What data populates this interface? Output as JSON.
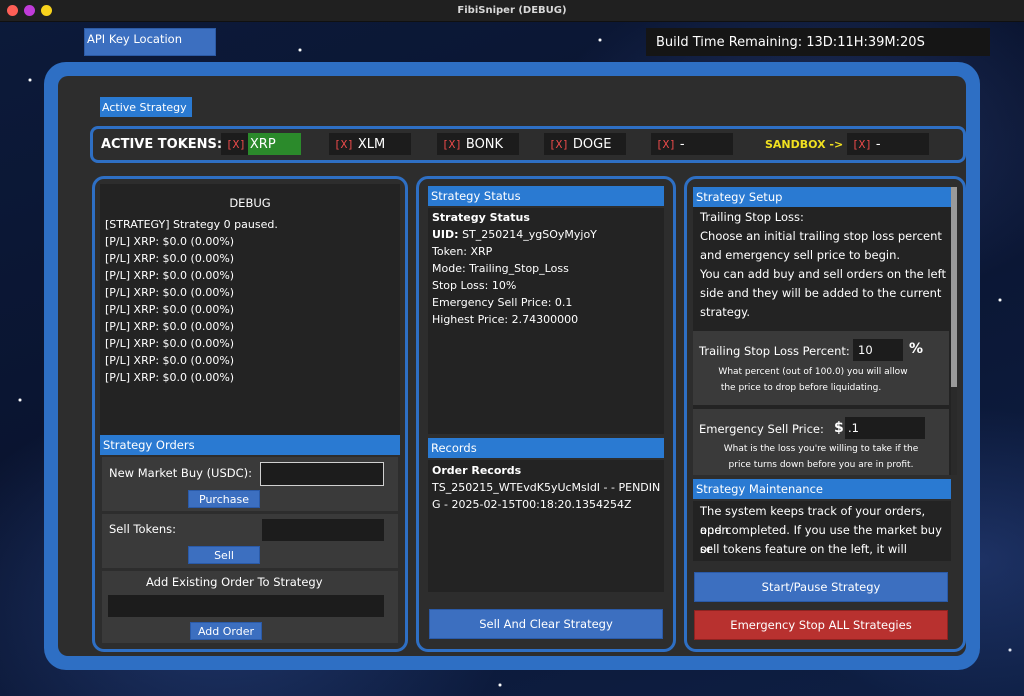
{
  "window": {
    "title": "FibiSniper (DEBUG)"
  },
  "top": {
    "api_key_label": "API Key Location",
    "build_time": "Build Time Remaining: 13D:11H:39M:20S"
  },
  "active_strategy_tab": "Active Strategy",
  "tokens": {
    "label": "ACTIVE TOKENS:",
    "sandbox_label": "SANDBOX ->",
    "remove_marker": "[X]",
    "items": [
      {
        "name": "XRP",
        "selected": true
      },
      {
        "name": "XLM",
        "selected": false
      },
      {
        "name": "BONK",
        "selected": false
      },
      {
        "name": "DOGE",
        "selected": false
      },
      {
        "name": "-",
        "selected": false
      }
    ],
    "sandbox_item": {
      "name": "-"
    }
  },
  "debug": {
    "title": "DEBUG",
    "lines": [
      "[STRATEGY] Strategy 0 paused.",
      "[P/L] XRP: $0.0 (0.00%)",
      "[P/L] XRP: $0.0 (0.00%)",
      "[P/L] XRP: $0.0 (0.00%)",
      "[P/L] XRP: $0.0 (0.00%)",
      "[P/L] XRP: $0.0 (0.00%)",
      "[P/L] XRP: $0.0 (0.00%)",
      "[P/L] XRP: $0.0 (0.00%)",
      "[P/L] XRP: $0.0 (0.00%)",
      "[P/L] XRP: $0.0 (0.00%)"
    ]
  },
  "strategy_orders": {
    "header": "Strategy Orders",
    "market_buy_label": "New Market Buy (USDC):",
    "market_buy_value": "",
    "purchase_label": "Purchase",
    "sell_tokens_label": "Sell Tokens:",
    "sell_tokens_value": "",
    "sell_label": "Sell",
    "add_existing_label": "Add Existing Order To Strategy",
    "add_existing_value": "",
    "add_order_label": "Add Order"
  },
  "strategy_status": {
    "header": "Strategy Status",
    "heading": "Strategy Status",
    "uid_key": "UID:",
    "uid_value": "ST_250214_ygSOyMyjoY",
    "token": "Token: XRP",
    "mode": "Mode: Trailing_Stop_Loss",
    "stop_loss": "Stop Loss: 10%",
    "emergency_sell": "Emergency Sell Price: 0.1",
    "highest_price": "Highest Price: 2.74300000"
  },
  "records": {
    "header": "Records",
    "heading": "Order Records",
    "line1": "TS_250215_WTEvdK5yUcMsldI -  - PENDIN",
    "line2": "G - 2025-02-15T00:18:20.1354254Z"
  },
  "sell_clear_label": "Sell And Clear Strategy",
  "strategy_setup": {
    "header": "Strategy Setup",
    "lines": [
      "Trailing Stop Loss:",
      " Choose an initial trailing stop loss percent",
      "and emergency sell price to begin.",
      " You can add buy and sell orders on the left",
      "side and they will be added to the current",
      "strategy."
    ],
    "tsl_label": "Trailing Stop Loss Percent:",
    "tsl_value": "10",
    "tsl_unit": "%",
    "tsl_note1": "What percent (out of 100.0) you will allow",
    "tsl_note2": "the price to drop before liquidating.",
    "esp_label": "Emergency Sell Price:",
    "esp_currency": "$",
    "esp_value": ".1",
    "esp_note1": "What is the loss you're willing to take if the",
    "esp_note2": "price turns down before you are in profit."
  },
  "strategy_maintenance": {
    "header": "Strategy Maintenance",
    "lines": [
      "The system keeps track of your orders, open",
      "and completed. If you use the market buy or",
      "sell tokens feature on the left, it will"
    ]
  },
  "start_pause_label": "Start/Pause Strategy",
  "emergency_stop_label": "Emergency Stop ALL Strategies",
  "colors": {
    "accent_blue": "#2e6fc4",
    "header_blue": "#2a7ad2",
    "selected_token": "#2b8a2b",
    "remove_red": "#ef4b4b",
    "sandbox_yellow": "#f0e020",
    "emergency_red": "#b8312f"
  }
}
